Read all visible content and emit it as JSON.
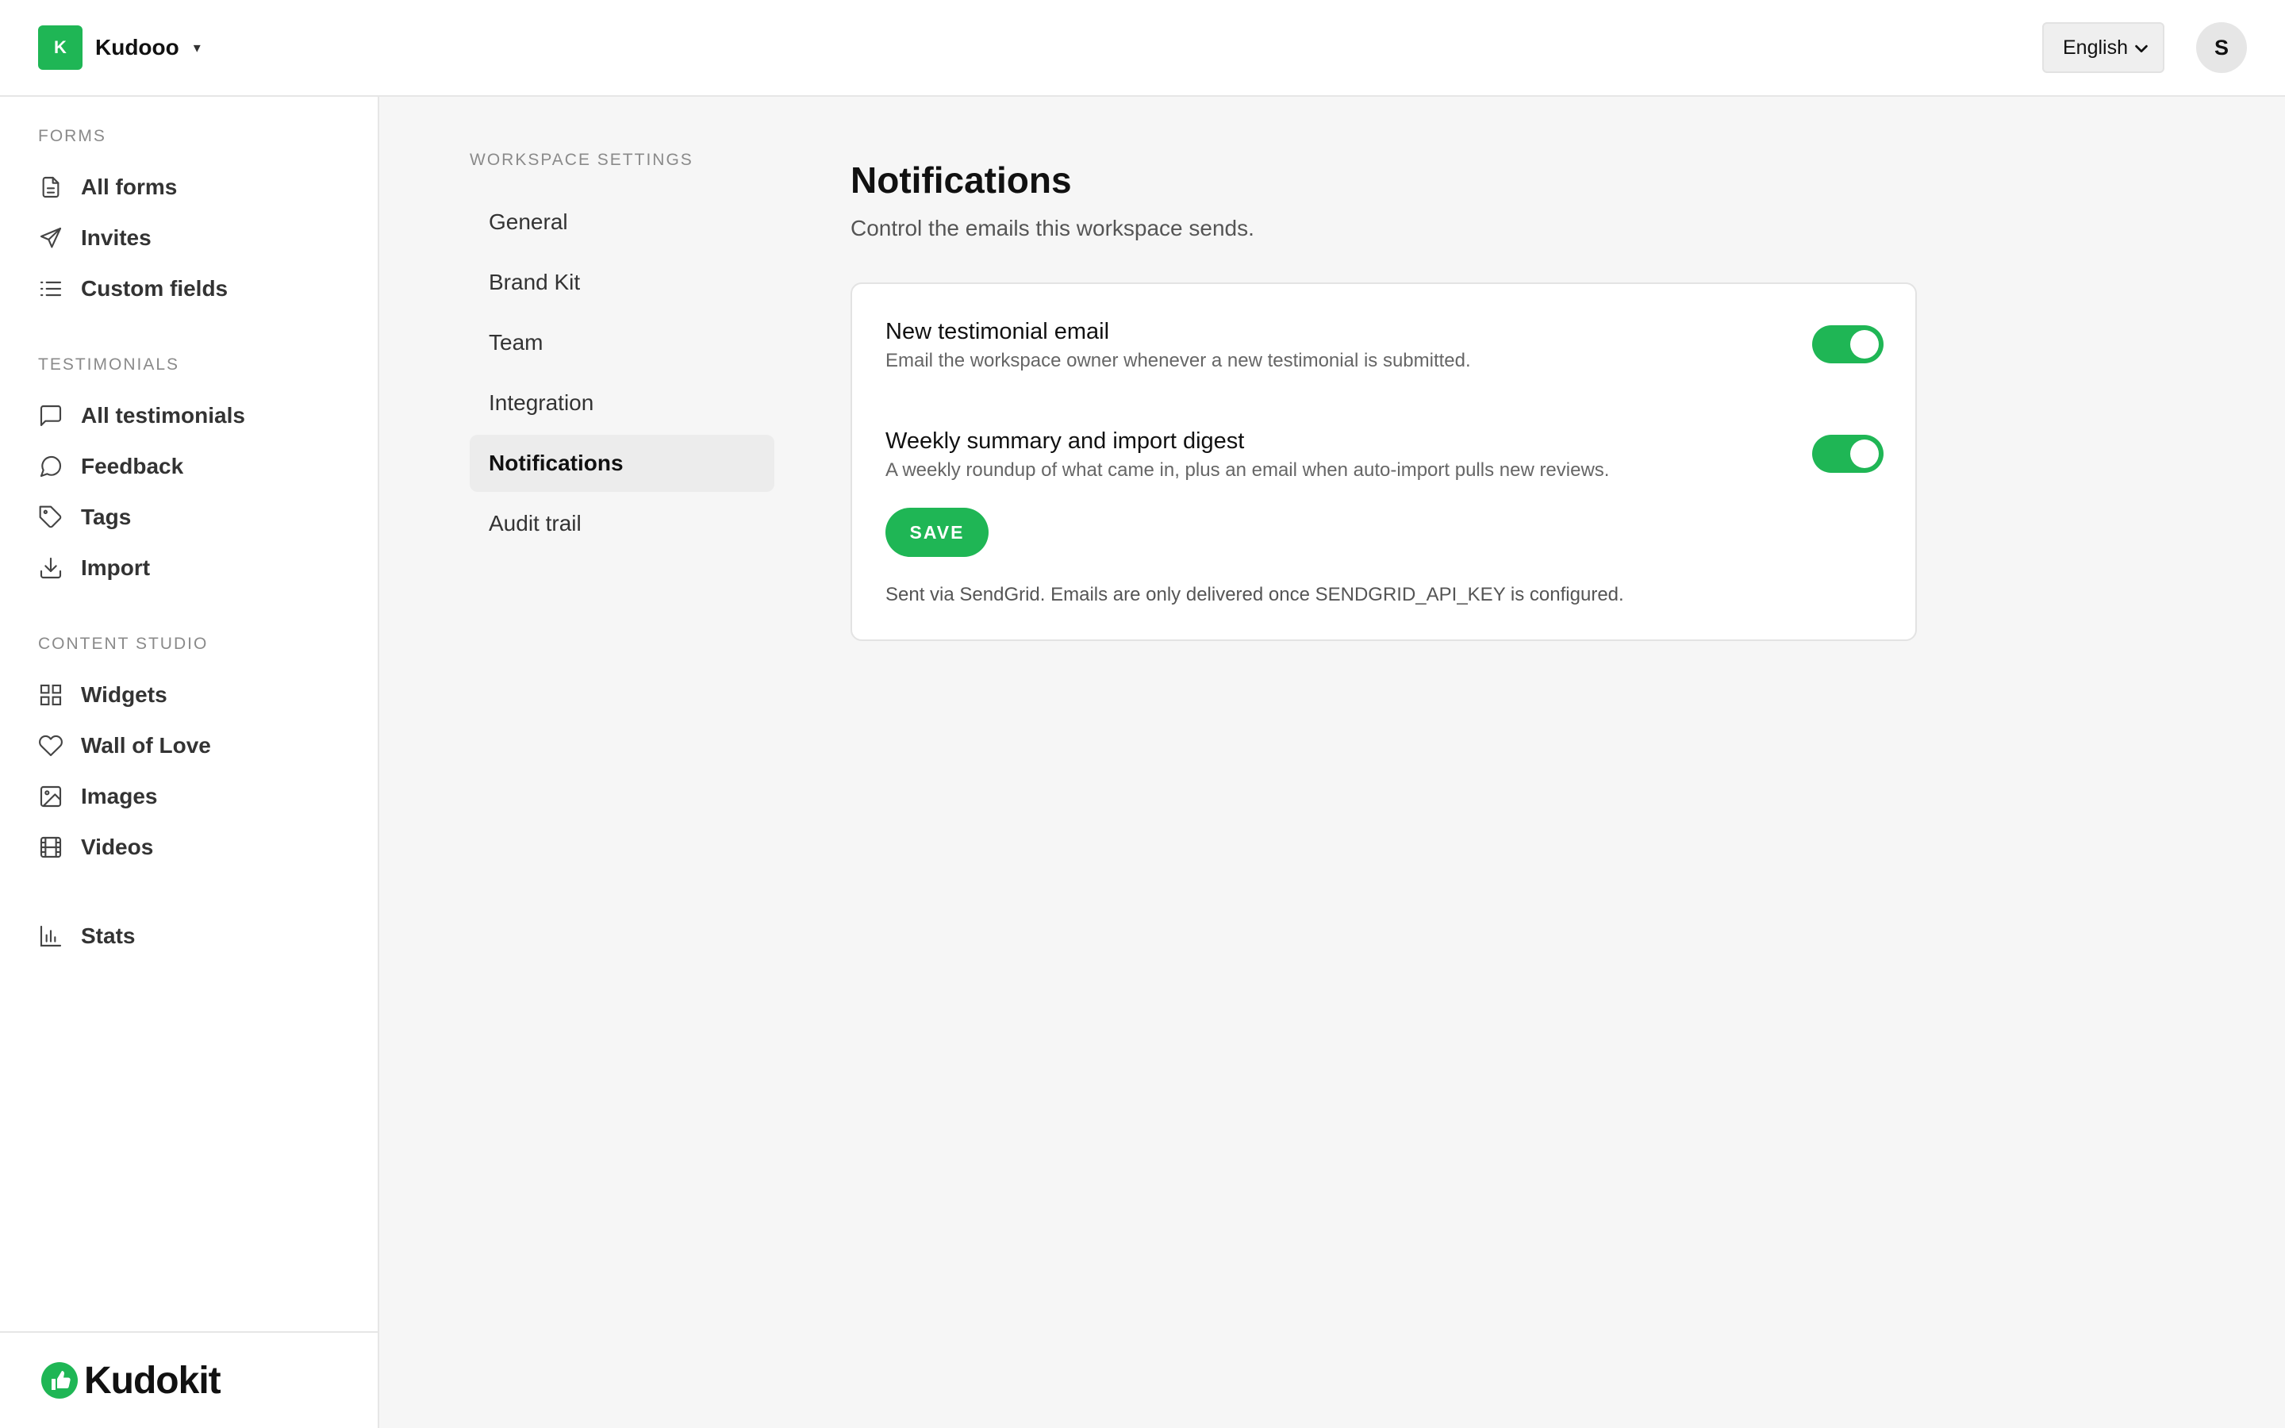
{
  "topbar": {
    "workspace_initial": "K",
    "workspace_name": "Kudooo",
    "workspace_caret": "▾",
    "language": "English",
    "avatar_initial": "S"
  },
  "sidebar": {
    "sections": {
      "forms": "FORMS",
      "testimonials": "TESTIMONIALS",
      "content_studio": "CONTENT STUDIO"
    },
    "items": [
      {
        "label": "All forms",
        "icon": "document-icon"
      },
      {
        "label": "Invites",
        "icon": "send-icon"
      },
      {
        "label": "Custom fields",
        "icon": "list-icon"
      },
      {
        "label": "All testimonials",
        "icon": "chat-square-icon"
      },
      {
        "label": "Feedback",
        "icon": "chat-bubble-icon"
      },
      {
        "label": "Tags",
        "icon": "tag-icon"
      },
      {
        "label": "Import",
        "icon": "download-icon"
      },
      {
        "label": "Widgets",
        "icon": "grid-icon"
      },
      {
        "label": "Wall of Love",
        "icon": "heart-icon"
      },
      {
        "label": "Images",
        "icon": "image-icon"
      },
      {
        "label": "Videos",
        "icon": "film-icon"
      },
      {
        "label": "Stats",
        "icon": "bar-chart-icon"
      }
    ],
    "brand": "Kudokit"
  },
  "settings_nav": {
    "title": "WORKSPACE SETTINGS",
    "items": [
      "General",
      "Brand Kit",
      "Team",
      "Integration",
      "Notifications",
      "Audit trail"
    ],
    "active": "Notifications"
  },
  "main": {
    "title": "Notifications",
    "subtitle": "Control the emails this workspace sends.",
    "settings": [
      {
        "title": "New testimonial email",
        "description": "Email the workspace owner whenever a new testimonial is submitted.",
        "enabled": true
      },
      {
        "title": "Weekly summary and import digest",
        "description": "A weekly roundup of what came in, plus an email when auto-import pulls new reviews.",
        "enabled": true
      }
    ],
    "save_label": "SAVE",
    "note": "Sent via SendGrid. Emails are only delivered once SENDGRID_API_KEY is configured."
  },
  "colors": {
    "accent": "#1fb655",
    "active_nav_bg": "#ececec"
  }
}
